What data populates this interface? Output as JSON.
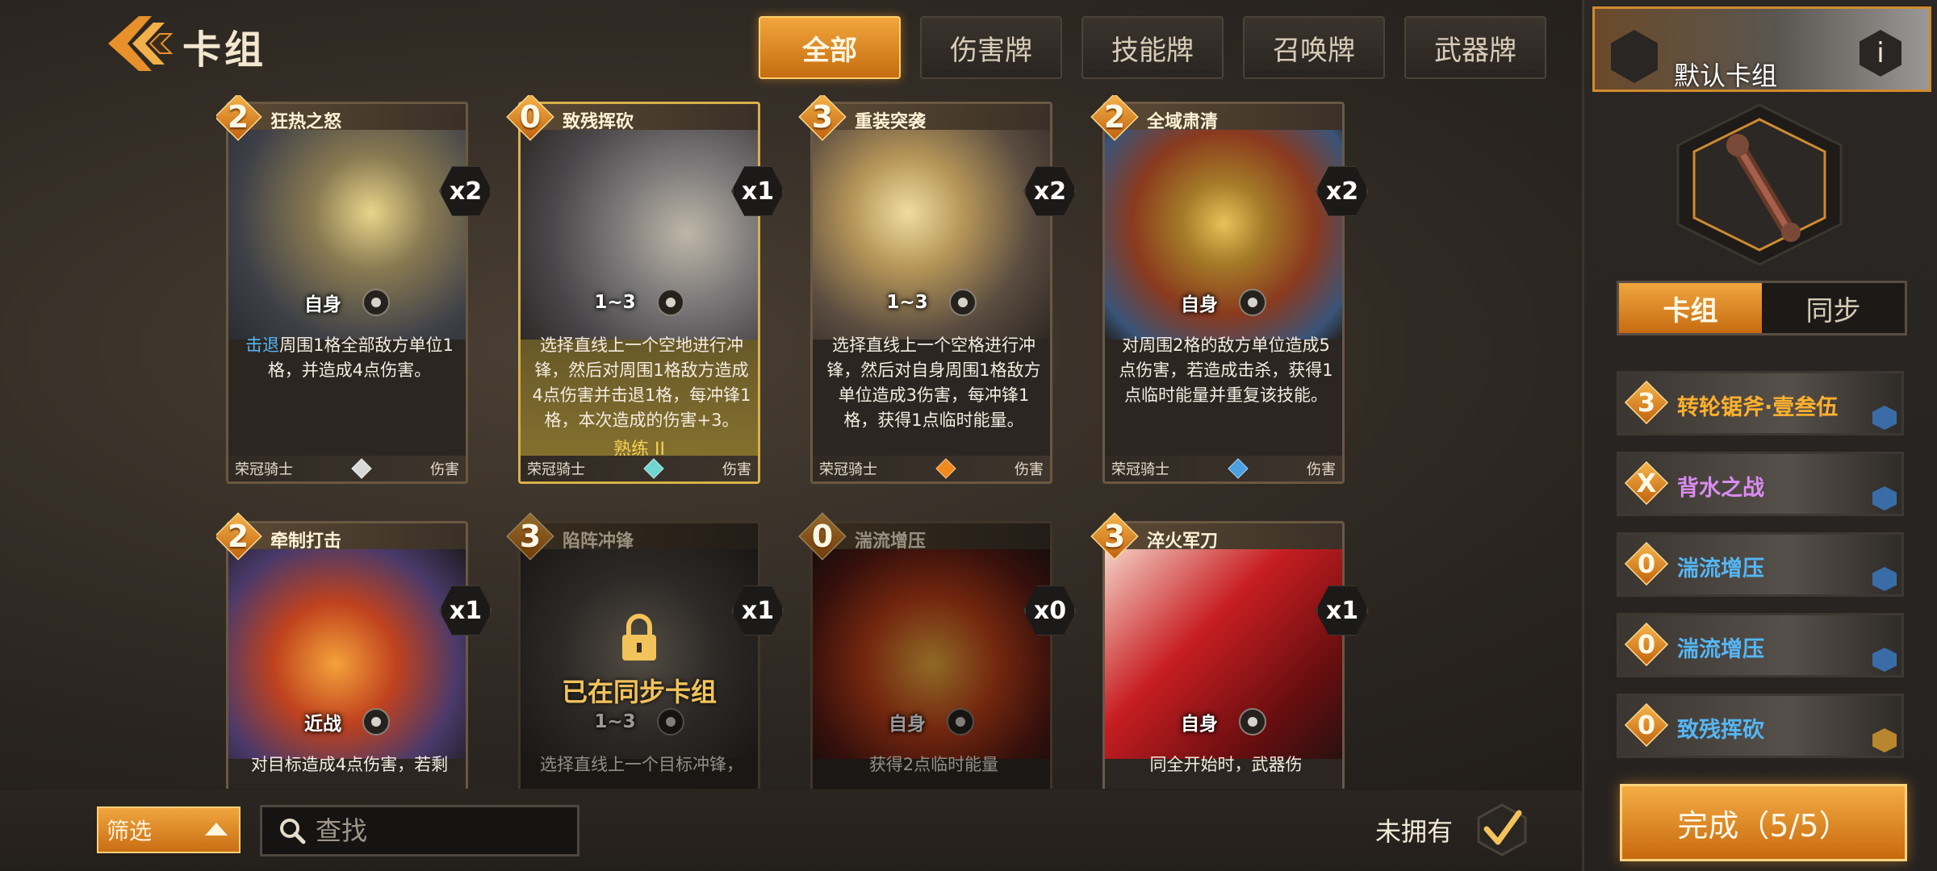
{
  "header": {
    "title": "卡组",
    "tabs": [
      {
        "label": "全部",
        "active": true
      },
      {
        "label": "伤害牌",
        "active": false
      },
      {
        "label": "技能牌",
        "active": false
      },
      {
        "label": "召唤牌",
        "active": false
      },
      {
        "label": "武器牌",
        "active": false
      }
    ]
  },
  "cards": [
    {
      "cost": "2",
      "name": "狂热之怒",
      "count": "x2",
      "range": "自身",
      "desc_kw": "击退",
      "desc": "周围1格全部敌方单位1格，并造成4点伤害。",
      "faction": "荣冠骑士",
      "type": "伤害",
      "gem_color": "#d8d8d8"
    },
    {
      "cost": "0",
      "name": "致残挥砍",
      "count": "x1",
      "range": "1~3",
      "desc": "选择直线上一个空地进行冲锋，然后对周围1格敌方造成4点伤害并击退1格，每冲锋1格，本次造成的伤害+3。",
      "mastery": "熟练 II",
      "faction": "荣冠骑士",
      "type": "伤害",
      "gem_color": "#6fd6d0"
    },
    {
      "cost": "3",
      "name": "重装突袭",
      "count": "x2",
      "range": "1~3",
      "desc": "选择直线上一个空格进行冲锋，然后对自身周围1格敌方单位造成3伤害，每冲锋1格，获得1点临时能量。",
      "faction": "荣冠骑士",
      "type": "伤害",
      "gem_color": "#f08a1c"
    },
    {
      "cost": "2",
      "name": "全域肃清",
      "count": "x2",
      "range": "自身",
      "desc": "对周围2格的敌方单位造成5点伤害，若造成击杀，获得1点临时能量并重复该技能。",
      "faction": "荣冠骑士",
      "type": "伤害",
      "gem_color": "#4aa0e0"
    },
    {
      "cost": "2",
      "name": "牵制打击",
      "count": "x1",
      "range": "近战",
      "desc": "对目标造成4点伤害，若剩"
    },
    {
      "cost": "3",
      "name": "陷阵冲锋",
      "count": "x1",
      "range": "1~3",
      "locked_text": "已在同步卡组",
      "desc": "选择直线上一个目标冲锋，"
    },
    {
      "cost": "0",
      "name": "湍流增压",
      "count": "x0",
      "range": "自身",
      "desc": "获得2点临时能量"
    },
    {
      "cost": "3",
      "name": "淬火军刀",
      "count": "x1",
      "range": "自身",
      "desc": "同全开始时，武器伤"
    }
  ],
  "bottom": {
    "filter_label": "筛选",
    "search_placeholder": "查找",
    "unowned_label": "未拥有"
  },
  "deck_panel": {
    "deck_name": "默认卡组",
    "info_label": "i",
    "sub_tabs": [
      {
        "label": "卡组",
        "active": true
      },
      {
        "label": "同步",
        "active": false
      }
    ],
    "items": [
      {
        "cost": "3",
        "name": "转轮锯斧·壹叁伍",
        "name_color": "#ffb02e"
      },
      {
        "cost": "X",
        "name": "背水之战",
        "name_color": "#d98cf2"
      },
      {
        "cost": "0",
        "name": "湍流增压",
        "name_color": "#55b6f4"
      },
      {
        "cost": "0",
        "name": "湍流增压",
        "name_color": "#55b6f4"
      },
      {
        "cost": "0",
        "name": "致残挥砍",
        "name_color": "#55b6f4"
      }
    ],
    "done_label": "完成（5/5）"
  },
  "colors": {
    "accent": "#e8912a",
    "keyword": "#55b6f4",
    "mastery": "#f2cf54"
  }
}
